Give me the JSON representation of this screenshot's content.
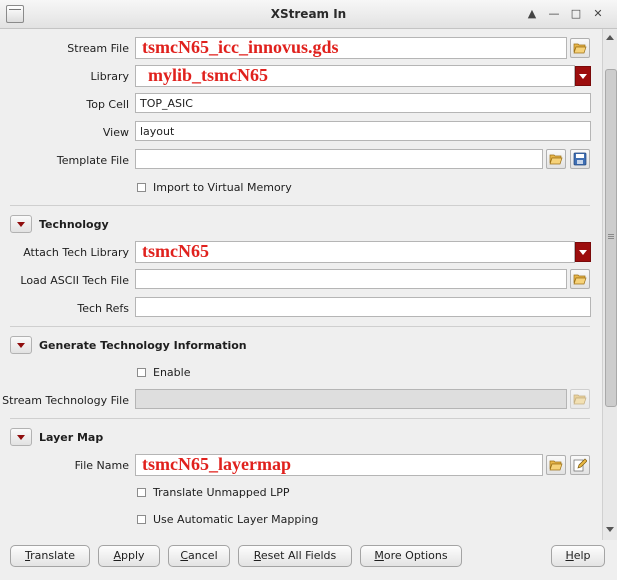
{
  "window": {
    "title": "XStream In",
    "controls": [
      "▲",
      "—",
      "□",
      "✕"
    ]
  },
  "stream_file": {
    "label": "Stream File",
    "value": "tsmcN65_icc_innovus.gds"
  },
  "library": {
    "label": "Library",
    "value": "mylib_tsmcN65"
  },
  "top_cell": {
    "label": "Top Cell",
    "value": "TOP_ASIC"
  },
  "view": {
    "label": "View",
    "value": "layout"
  },
  "template_file": {
    "label": "Template File",
    "value": ""
  },
  "import_virtual_memory": {
    "label": "Import to Virtual Memory",
    "checked": false
  },
  "technology": {
    "title": "Technology",
    "attach_tech_library": {
      "label": "Attach Tech Library",
      "value": "tsmcN65"
    },
    "load_ascii_tech_file": {
      "label": "Load ASCII Tech File",
      "value": ""
    },
    "tech_refs": {
      "label": "Tech Refs",
      "value": ""
    }
  },
  "generate_tech_info": {
    "title": "Generate Technology Information",
    "enable": {
      "label": "Enable",
      "checked": false
    },
    "stream_technology_file": {
      "label": "Stream Technology File",
      "value": ""
    }
  },
  "layer_map": {
    "title": "Layer Map",
    "file_name": {
      "label": "File Name",
      "value": "tsmcN65_layermap"
    },
    "translate_unmapped_lpp": {
      "label": "Translate Unmapped LPP",
      "checked": false
    },
    "use_automatic_layer_mapping": {
      "label": "Use Automatic Layer Mapping",
      "checked": false
    }
  },
  "buttons": {
    "translate": {
      "first": "T",
      "rest": "ranslate"
    },
    "apply": {
      "first": "A",
      "rest": "pply"
    },
    "cancel": {
      "first": "C",
      "rest": "ancel"
    },
    "reset_all_fields": {
      "first": "R",
      "rest": "eset All Fields"
    },
    "more_options": {
      "first": "M",
      "rest": "ore Options"
    },
    "help": {
      "first": "H",
      "rest": "elp"
    }
  },
  "colors": {
    "accent": "#e0211d",
    "dropdown": "#9d0e0e"
  }
}
